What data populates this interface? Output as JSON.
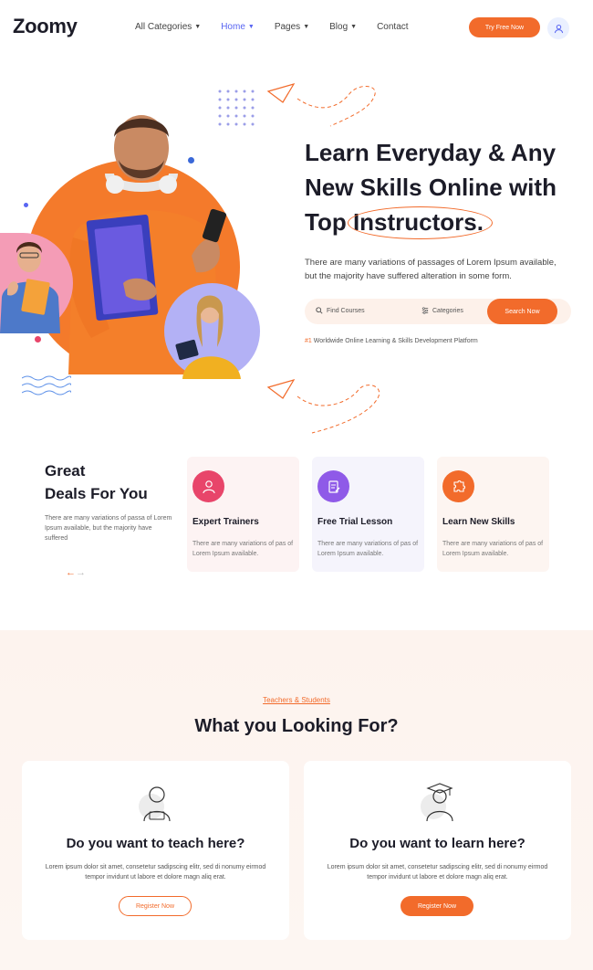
{
  "header": {
    "logo": "Zoomy",
    "nav": [
      {
        "label": "All Categories",
        "active": false
      },
      {
        "label": "Home",
        "active": true
      },
      {
        "label": "Pages",
        "active": false
      },
      {
        "label": "Blog",
        "active": false
      },
      {
        "label": "Contact",
        "active": false
      }
    ],
    "cta": "Try Free Now"
  },
  "hero": {
    "title_line1": "Learn Everyday & Any",
    "title_line2": "New Skills Online with",
    "title_line3_pre": "Top ",
    "title_line3_circled": "Instructors.",
    "description": "There are many variations of passages of Lorem Ipsum available, but the majority have suffered alteration in some form.",
    "search": {
      "placeholder": "Find Courses",
      "category": "Categories",
      "button": "Search Now"
    },
    "tagline_highlight": "#1",
    "tagline": " Worldwide Online Learning & Skills Development Platform"
  },
  "deals": {
    "title_line1": "Great",
    "title_line2": "Deals For You",
    "description": "There are many variations of passa of Lorem Ipsum available, but the majority have suffered",
    "cards": [
      {
        "title": "Expert Trainers",
        "desc": "There are many variations of pas of Lorem Ipsum available."
      },
      {
        "title": "Free Trial Lesson",
        "desc": "There are many variations of pas of Lorem Ipsum available."
      },
      {
        "title": "Learn New Skills",
        "desc": "There are many variations of pas of Lorem Ipsum available."
      }
    ]
  },
  "teachers": {
    "subtitle": "Teachers & Students",
    "title": "What you Looking For?",
    "cards": [
      {
        "title": "Do you want to teach here?",
        "desc": "Lorem ipsum dolor sit amet, consetetur sadipscing elitr, sed di nonumy eirmod tempor invidunt ut labore et dolore magn aliq erat.",
        "button": "Register Now"
      },
      {
        "title": "Do you want to learn here?",
        "desc": "Lorem ipsum dolor sit amet, consetetur sadipscing elitr, sed di nonumy eirmod tempor invidunt ut labore et dolore magn aliq erat.",
        "button": "Register Now"
      }
    ]
  },
  "colors": {
    "accent": "#f26b2b",
    "nav_active": "#5865f2",
    "card_pink": "#fdf3f3",
    "card_lavender": "#f5f4fc",
    "card_peach": "#fdf5f1"
  }
}
